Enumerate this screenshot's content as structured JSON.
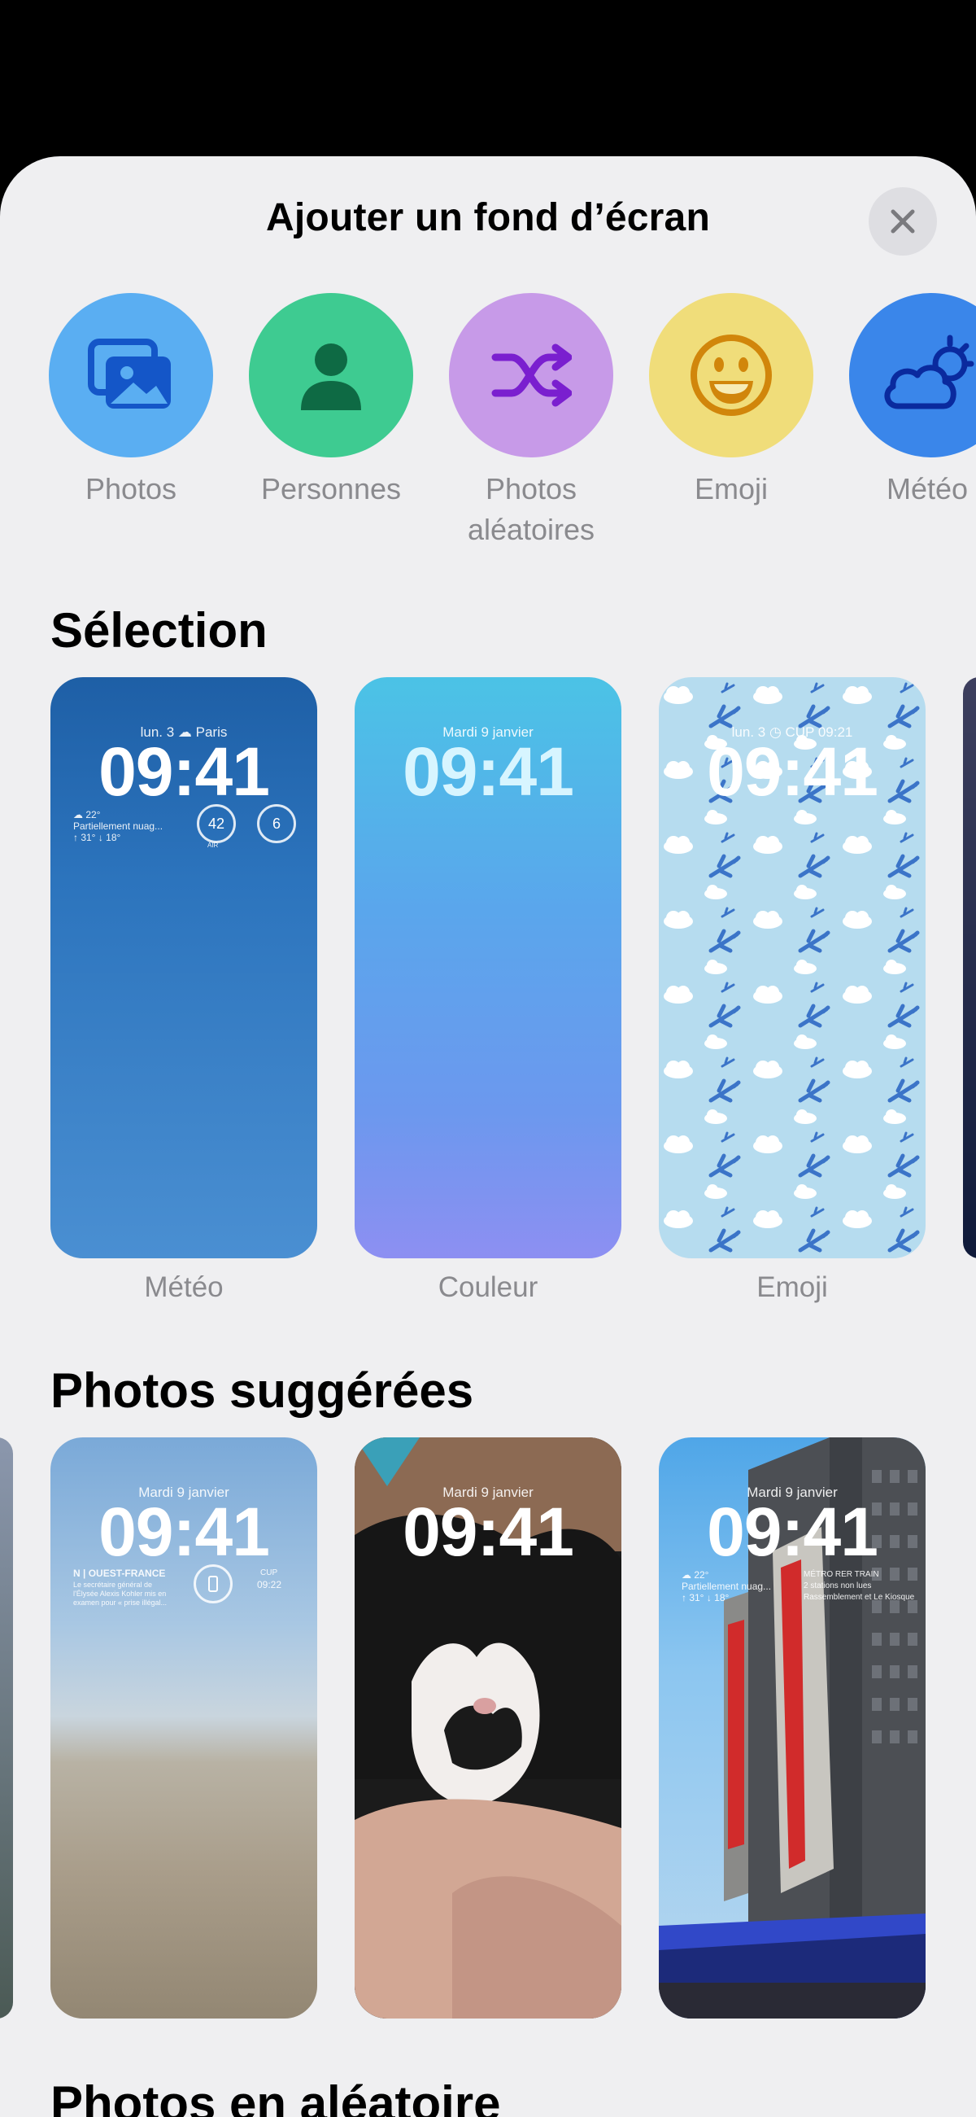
{
  "sheet": {
    "title": "Ajouter un fond d’écran"
  },
  "categories": [
    {
      "label": "Photos",
      "icon": "photos-icon",
      "color": "#5aaef2"
    },
    {
      "label": "Personnes",
      "icon": "person-icon",
      "color": "#3ecb91"
    },
    {
      "label": "Photos aléatoires",
      "icon": "shuffle-icon",
      "color": "#c79ae8"
    },
    {
      "label": "Emoji",
      "icon": "smiley-icon",
      "color": "#f0dd7a"
    },
    {
      "label": "Météo",
      "icon": "cloud-sun-icon",
      "color": "#3a86ea"
    }
  ],
  "selection": {
    "heading": "Sélection",
    "cards": [
      {
        "caption": "Météo",
        "date": "lun. 3  ☁ Paris",
        "time": "09:41",
        "weather_temp": "☁ 22°",
        "weather_desc": "Partiellement nuag...",
        "weather_range": "↑ 31° ↓ 18°",
        "gauge1": "42",
        "gauge1_label": "AIR",
        "gauge2": "6"
      },
      {
        "caption": "Couleur",
        "date": "Mardi 9 janvier",
        "time": "09:41"
      },
      {
        "caption": "Emoji",
        "date": "lun. 3  ◷ CUP 09:21",
        "time": "09:41"
      }
    ]
  },
  "suggested": {
    "heading": "Photos suggérées",
    "cards": [
      {
        "date": "Mardi 9 janvier",
        "time": "09:41",
        "news_source": "N | OUEST-FRANCE",
        "news_text": "Le secrétaire général de l'Élysée Alexis Kohler mis en examen pour « prise illégal...",
        "cup_label": "CUP",
        "cup_time": "09:22"
      },
      {
        "date": "Mardi 9 janvier",
        "time": "09:41"
      },
      {
        "date": "Mardi 9 janvier",
        "time": "09:41",
        "weather_temp": "☁ 22°",
        "weather_desc": "Partiellement nuag...",
        "weather_range": "↑ 31° ↓ 18°",
        "transit_line1": "MÉTRO RER TRAIN",
        "transit_line2": "2 stations non lues",
        "transit_line3": "Rassemblement et Le Kiosque"
      }
    ]
  },
  "random": {
    "heading": "Photos en aléatoire"
  }
}
